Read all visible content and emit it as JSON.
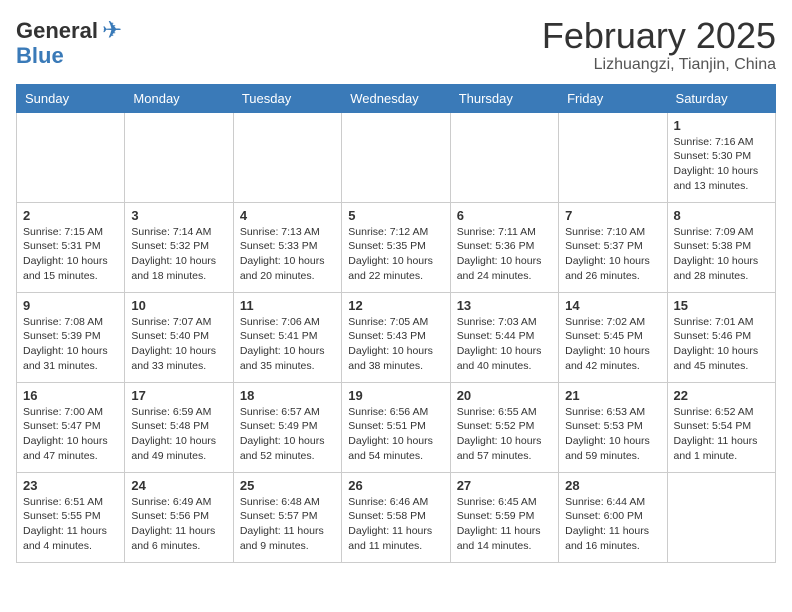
{
  "header": {
    "logo_general": "General",
    "logo_blue": "Blue",
    "month": "February 2025",
    "location": "Lizhuangzi, Tianjin, China"
  },
  "days_of_week": [
    "Sunday",
    "Monday",
    "Tuesday",
    "Wednesday",
    "Thursday",
    "Friday",
    "Saturday"
  ],
  "weeks": [
    [
      {
        "day": "",
        "info": ""
      },
      {
        "day": "",
        "info": ""
      },
      {
        "day": "",
        "info": ""
      },
      {
        "day": "",
        "info": ""
      },
      {
        "day": "",
        "info": ""
      },
      {
        "day": "",
        "info": ""
      },
      {
        "day": "1",
        "info": "Sunrise: 7:16 AM\nSunset: 5:30 PM\nDaylight: 10 hours\nand 13 minutes."
      }
    ],
    [
      {
        "day": "2",
        "info": "Sunrise: 7:15 AM\nSunset: 5:31 PM\nDaylight: 10 hours\nand 15 minutes."
      },
      {
        "day": "3",
        "info": "Sunrise: 7:14 AM\nSunset: 5:32 PM\nDaylight: 10 hours\nand 18 minutes."
      },
      {
        "day": "4",
        "info": "Sunrise: 7:13 AM\nSunset: 5:33 PM\nDaylight: 10 hours\nand 20 minutes."
      },
      {
        "day": "5",
        "info": "Sunrise: 7:12 AM\nSunset: 5:35 PM\nDaylight: 10 hours\nand 22 minutes."
      },
      {
        "day": "6",
        "info": "Sunrise: 7:11 AM\nSunset: 5:36 PM\nDaylight: 10 hours\nand 24 minutes."
      },
      {
        "day": "7",
        "info": "Sunrise: 7:10 AM\nSunset: 5:37 PM\nDaylight: 10 hours\nand 26 minutes."
      },
      {
        "day": "8",
        "info": "Sunrise: 7:09 AM\nSunset: 5:38 PM\nDaylight: 10 hours\nand 28 minutes."
      }
    ],
    [
      {
        "day": "9",
        "info": "Sunrise: 7:08 AM\nSunset: 5:39 PM\nDaylight: 10 hours\nand 31 minutes."
      },
      {
        "day": "10",
        "info": "Sunrise: 7:07 AM\nSunset: 5:40 PM\nDaylight: 10 hours\nand 33 minutes."
      },
      {
        "day": "11",
        "info": "Sunrise: 7:06 AM\nSunset: 5:41 PM\nDaylight: 10 hours\nand 35 minutes."
      },
      {
        "day": "12",
        "info": "Sunrise: 7:05 AM\nSunset: 5:43 PM\nDaylight: 10 hours\nand 38 minutes."
      },
      {
        "day": "13",
        "info": "Sunrise: 7:03 AM\nSunset: 5:44 PM\nDaylight: 10 hours\nand 40 minutes."
      },
      {
        "day": "14",
        "info": "Sunrise: 7:02 AM\nSunset: 5:45 PM\nDaylight: 10 hours\nand 42 minutes."
      },
      {
        "day": "15",
        "info": "Sunrise: 7:01 AM\nSunset: 5:46 PM\nDaylight: 10 hours\nand 45 minutes."
      }
    ],
    [
      {
        "day": "16",
        "info": "Sunrise: 7:00 AM\nSunset: 5:47 PM\nDaylight: 10 hours\nand 47 minutes."
      },
      {
        "day": "17",
        "info": "Sunrise: 6:59 AM\nSunset: 5:48 PM\nDaylight: 10 hours\nand 49 minutes."
      },
      {
        "day": "18",
        "info": "Sunrise: 6:57 AM\nSunset: 5:49 PM\nDaylight: 10 hours\nand 52 minutes."
      },
      {
        "day": "19",
        "info": "Sunrise: 6:56 AM\nSunset: 5:51 PM\nDaylight: 10 hours\nand 54 minutes."
      },
      {
        "day": "20",
        "info": "Sunrise: 6:55 AM\nSunset: 5:52 PM\nDaylight: 10 hours\nand 57 minutes."
      },
      {
        "day": "21",
        "info": "Sunrise: 6:53 AM\nSunset: 5:53 PM\nDaylight: 10 hours\nand 59 minutes."
      },
      {
        "day": "22",
        "info": "Sunrise: 6:52 AM\nSunset: 5:54 PM\nDaylight: 11 hours\nand 1 minute."
      }
    ],
    [
      {
        "day": "23",
        "info": "Sunrise: 6:51 AM\nSunset: 5:55 PM\nDaylight: 11 hours\nand 4 minutes."
      },
      {
        "day": "24",
        "info": "Sunrise: 6:49 AM\nSunset: 5:56 PM\nDaylight: 11 hours\nand 6 minutes."
      },
      {
        "day": "25",
        "info": "Sunrise: 6:48 AM\nSunset: 5:57 PM\nDaylight: 11 hours\nand 9 minutes."
      },
      {
        "day": "26",
        "info": "Sunrise: 6:46 AM\nSunset: 5:58 PM\nDaylight: 11 hours\nand 11 minutes."
      },
      {
        "day": "27",
        "info": "Sunrise: 6:45 AM\nSunset: 5:59 PM\nDaylight: 11 hours\nand 14 minutes."
      },
      {
        "day": "28",
        "info": "Sunrise: 6:44 AM\nSunset: 6:00 PM\nDaylight: 11 hours\nand 16 minutes."
      },
      {
        "day": "",
        "info": ""
      }
    ]
  ]
}
